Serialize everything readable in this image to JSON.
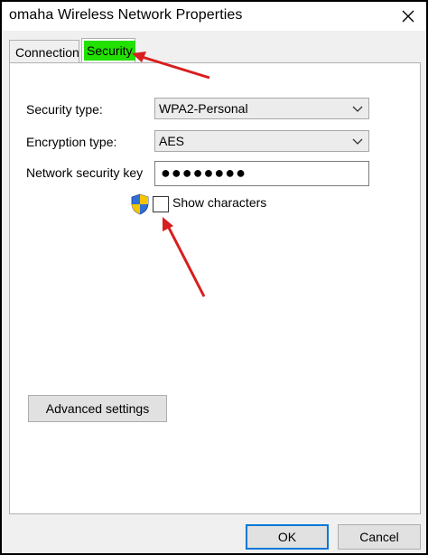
{
  "window": {
    "title": "omaha Wireless Network Properties"
  },
  "tabs": [
    {
      "label": "Connection"
    },
    {
      "label": "Security"
    }
  ],
  "security": {
    "security_type_label": "Security type:",
    "security_type_value": "WPA2-Personal",
    "encryption_type_label": "Encryption type:",
    "encryption_type_value": "AES",
    "key_label": "Network security key",
    "key_value": "●●●●●●●●",
    "show_characters_label": "Show characters"
  },
  "buttons": {
    "advanced": "Advanced settings",
    "ok": "OK",
    "cancel": "Cancel"
  },
  "colors": {
    "highlight": "#22e000",
    "annotation_arrow": "#d81e1e"
  }
}
